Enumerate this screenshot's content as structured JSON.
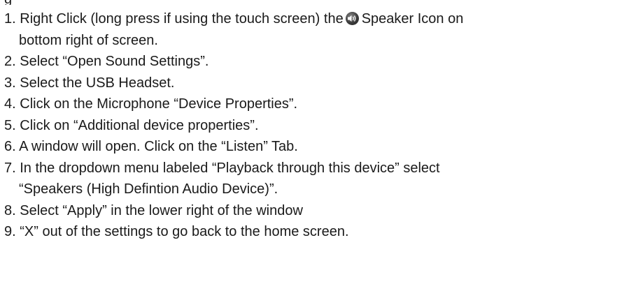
{
  "clipped_heading": "g",
  "icons": {
    "speaker": "speaker-icon"
  },
  "steps": [
    {
      "num": "1.",
      "before_icon": "Right Click (long press if using the touch screen) the",
      "after_icon": "Speaker Icon on",
      "continuation": "bottom right of screen."
    },
    {
      "num": "2.",
      "text": "Select “Open Sound Settings”."
    },
    {
      "num": "3.",
      "text": "Select the USB Headset."
    },
    {
      "num": "4.",
      "text": "Click on the Microphone “Device Properties”."
    },
    {
      "num": "5.",
      "text": "Click on “Additional device properties”."
    },
    {
      "num": "6.",
      "text": "A window will open. Click on the “Listen” Tab."
    },
    {
      "num": "7.",
      "text": "In the dropdown menu labeled “Playback through this device” select",
      "continuation": "“Speakers (High Defintion Audio Device)”."
    },
    {
      "num": "8.",
      "text": "Select “Apply” in the lower right of the window"
    },
    {
      "num": "9.",
      "text": "“X” out of the settings to go back to the home screen."
    }
  ]
}
